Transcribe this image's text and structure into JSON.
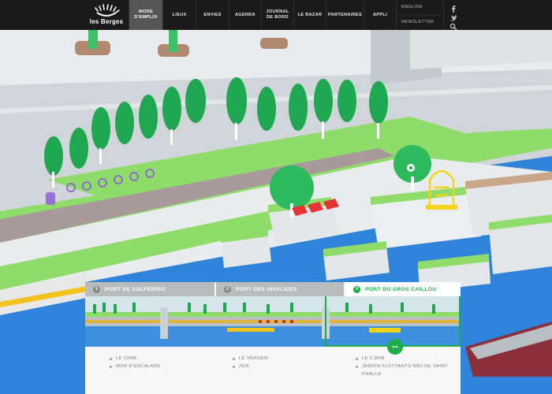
{
  "nav": {
    "logo_text": "les Berges",
    "items": [
      {
        "label": "MODE D'EMPLOI",
        "active": true
      },
      {
        "label": "LIEUX",
        "active": false
      },
      {
        "label": "ENVIES",
        "active": false
      },
      {
        "label": "AGENDA",
        "active": false
      },
      {
        "label": "JOURNAL DE BORD",
        "active": false
      },
      {
        "label": "LE BAZAR",
        "active": false
      },
      {
        "label": "PARTENAIRES",
        "active": false
      },
      {
        "label": "APPLI",
        "active": false
      }
    ],
    "english_label": "ENGLISH",
    "newsletter_label": "NEWSLETTER",
    "social_icons": [
      "facebook-icon",
      "twitter-icon",
      "search-icon"
    ]
  },
  "ports": {
    "tabs": [
      {
        "num": "1",
        "label": "PORT DE SOLFÉRINO",
        "active": false
      },
      {
        "num": "2",
        "label": "PORT DES INVALIDES",
        "active": false
      },
      {
        "num": "3",
        "label": "PORT DU GROS CAILLOU",
        "active": true
      }
    ],
    "features": [
      [
        "LE 100M",
        "MUR D'ESCALADE"
      ],
      [
        "LE VERGER",
        "ZEN"
      ],
      [
        "LE 2,3KM",
        "JARDIN FLOTTANTS NIKI DE SAINT PHALLE"
      ]
    ],
    "zoom_icon": "zoom-icon"
  },
  "colors": {
    "accent_green": "#1dae49",
    "river_blue": "#2f83d8",
    "nav_bg": "#1a1a1a",
    "grass": "#8fdc6a"
  }
}
